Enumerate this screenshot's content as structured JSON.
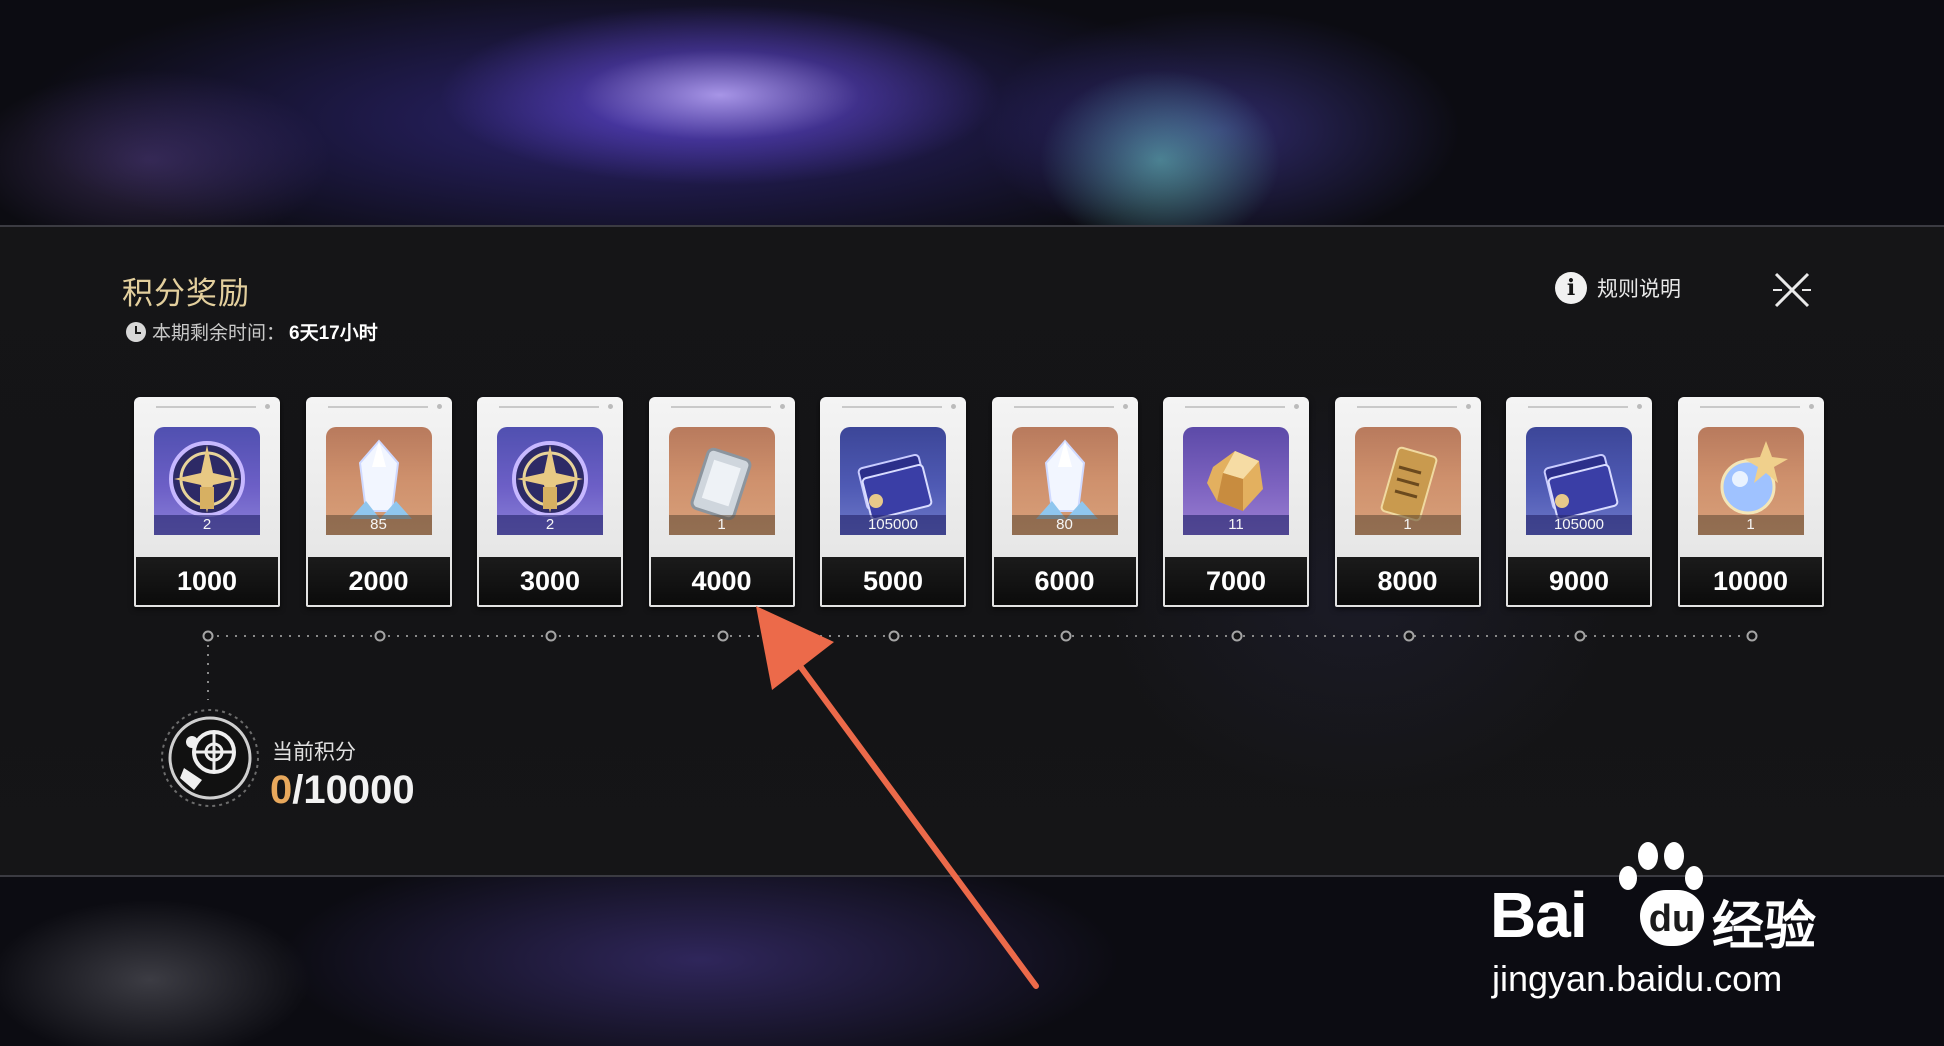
{
  "header": {
    "title": "积分奖励",
    "timer_label": "本期剩余时间：",
    "timer_value": "6天17小时"
  },
  "actions": {
    "rules_label": "规则说明"
  },
  "rewards": [
    {
      "score": "1000",
      "qty": "2",
      "item": "star-medal"
    },
    {
      "score": "2000",
      "qty": "85",
      "item": "crystal"
    },
    {
      "score": "3000",
      "qty": "2",
      "item": "star-medal"
    },
    {
      "score": "4000",
      "qty": "1",
      "item": "device"
    },
    {
      "score": "5000",
      "qty": "105000",
      "item": "credit-card"
    },
    {
      "score": "6000",
      "qty": "80",
      "item": "crystal"
    },
    {
      "score": "7000",
      "qty": "11",
      "item": "ore"
    },
    {
      "score": "8000",
      "qty": "1",
      "item": "ticket"
    },
    {
      "score": "9000",
      "qty": "105000",
      "item": "credit-card"
    },
    {
      "score": "10000",
      "qty": "1",
      "item": "orb"
    }
  ],
  "current": {
    "label": "当前积分",
    "value": "0",
    "max": "/10000"
  },
  "watermark": {
    "brand_left": "Bai",
    "brand_du": "du",
    "brand_right": "经验",
    "url": "jingyan.baidu.com"
  },
  "colors": {
    "title_gold": "#e3cf9d",
    "current_orange": "#e8a85c",
    "arrow": "#ec6a4a"
  }
}
